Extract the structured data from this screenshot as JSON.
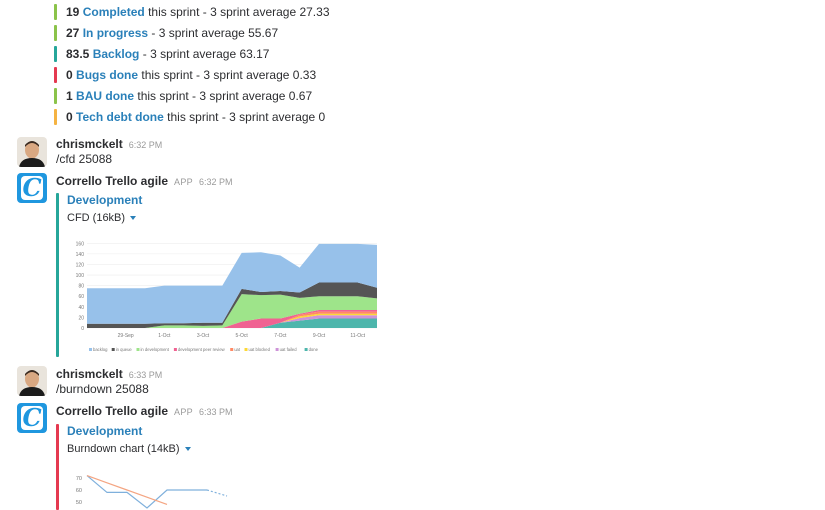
{
  "sprint_stats": [
    {
      "count": "19",
      "link": "Completed",
      "suffix": "this sprint - 3 sprint average 27.33",
      "color": "#8bc34a"
    },
    {
      "count": "27",
      "link": "In progress",
      "suffix": "- 3 sprint average 55.67",
      "color": "#8bc34a"
    },
    {
      "count": "83.5",
      "link": "Backlog",
      "suffix": "- 3 sprint average 63.17",
      "color": "#26a69a"
    },
    {
      "count": "0",
      "link": "Bugs done",
      "suffix": "this sprint - 3 sprint average 0.33",
      "color": "#e53950"
    },
    {
      "count": "1",
      "link": "BAU done",
      "suffix": "this sprint - 3 sprint average 0.67",
      "color": "#8bc34a"
    },
    {
      "count": "0",
      "link": "Tech debt done",
      "suffix": "this sprint - 3 sprint average 0",
      "color": "#f5b342"
    }
  ],
  "messages": [
    {
      "user": "chrismckelt",
      "time": "6:32 PM",
      "text": "/cfd 25088"
    },
    {
      "user": "Corrello Trello agile",
      "app_tag": "APP",
      "time": "6:32 PM",
      "attachment": {
        "title": "Development",
        "file": "CFD (16kB)",
        "bar_color": "#26a69a"
      }
    },
    {
      "user": "chrismckelt",
      "time": "6:33 PM",
      "text": "/burndown 25088"
    },
    {
      "user": "Corrello Trello agile",
      "app_tag": "APP",
      "time": "6:33 PM",
      "attachment": {
        "title": "Development",
        "file": "Burndown chart (14kB)",
        "bar_color": "#e53950"
      }
    }
  ],
  "app_avatar_letter": "C",
  "icons": {
    "user_avatar": "person-avatar",
    "app_avatar": "corrello-logo",
    "dropdown": "caret-down"
  },
  "chart_data": [
    {
      "type": "area",
      "x": [
        "27-Sep",
        "28-Sep",
        "29-Sep",
        "30-Sep",
        "1-Oct",
        "2-Oct",
        "3-Oct",
        "4-Oct",
        "5-Oct",
        "6-Oct",
        "7-Oct",
        "8-Oct",
        "9-Oct",
        "10-Oct",
        "11-Oct",
        "12-Oct"
      ],
      "x_tick_labels": [
        "29-Sep",
        "1-Oct",
        "3-Oct",
        "5-Oct",
        "7-Oct",
        "9-Oct",
        "11-Oct"
      ],
      "y_tick_labels": [
        "0",
        "20",
        "40",
        "60",
        "80",
        "100",
        "120",
        "140",
        "160"
      ],
      "ylim": [
        0,
        170
      ],
      "series": [
        {
          "name": "done",
          "color": "#4db6ac",
          "values": [
            0,
            0,
            0,
            0,
            0,
            0,
            0,
            0,
            0,
            0,
            10,
            14,
            18,
            18,
            18,
            18
          ]
        },
        {
          "name": "uat failed",
          "color": "#ce93d8",
          "values": [
            0,
            0,
            0,
            0,
            0,
            0,
            0,
            0,
            0,
            0,
            0,
            5,
            6,
            6,
            6,
            6
          ]
        },
        {
          "name": "uat blocked",
          "color": "#fdd835",
          "values": [
            0,
            0,
            0,
            0,
            0,
            0,
            0,
            0,
            0,
            0,
            0,
            3,
            3,
            3,
            3,
            3
          ]
        },
        {
          "name": "uat",
          "color": "#ff8a65",
          "values": [
            0,
            0,
            0,
            0,
            0,
            0,
            0,
            0,
            0,
            0,
            0,
            3,
            4,
            4,
            4,
            4
          ]
        },
        {
          "name": "development peer review",
          "color": "#f06292",
          "values": [
            0,
            0,
            0,
            0,
            0,
            0,
            0,
            0,
            12,
            18,
            8,
            2,
            3,
            3,
            3,
            3
          ]
        },
        {
          "name": "in development",
          "color": "#9ee48a",
          "values": [
            0,
            0,
            0,
            0,
            5,
            5,
            4,
            5,
            52,
            44,
            45,
            30,
            26,
            26,
            26,
            22
          ]
        },
        {
          "name": "in queue",
          "color": "#555555",
          "values": [
            8,
            8,
            8,
            8,
            4,
            4,
            6,
            5,
            10,
            6,
            7,
            10,
            26,
            26,
            26,
            20
          ]
        },
        {
          "name": "backlog",
          "color": "#97c1ea",
          "values": [
            67,
            67,
            67,
            67,
            71,
            71,
            70,
            70,
            68,
            75,
            67,
            47,
            73,
            73,
            73,
            81
          ]
        }
      ]
    },
    {
      "type": "line",
      "y_tick_labels": [
        "50",
        "60",
        "70"
      ],
      "series": [
        {
          "name": "",
          "color": "#7fb0dc",
          "values": [
            72,
            58,
            58,
            45,
            60,
            60,
            60
          ]
        },
        {
          "name": "",
          "color": "#f4a582",
          "values": [
            72,
            66,
            60,
            54,
            48
          ]
        }
      ]
    }
  ]
}
